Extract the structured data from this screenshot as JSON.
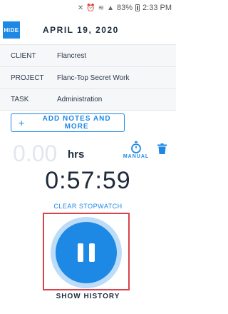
{
  "status_bar": {
    "battery": "83%",
    "time": "2:33 PM"
  },
  "header": {
    "hide_label": "HIDE",
    "date": "APRIL 19, 2020"
  },
  "fields": [
    {
      "label": "CLIENT",
      "value": "Flancrest"
    },
    {
      "label": "PROJECT",
      "value": "Flanc-Top Secret Work"
    },
    {
      "label": "TASK",
      "value": "Administration"
    }
  ],
  "notes_button": {
    "plus": "+",
    "label": "ADD NOTES AND MORE"
  },
  "hours": {
    "value": "0.00",
    "unit": "hrs"
  },
  "manual": {
    "label": "MANUAL",
    "icon": "stopwatch-icon"
  },
  "delete": {
    "icon": "trash-icon"
  },
  "timer": {
    "elapsed": "0:57:59"
  },
  "clear_label": "CLEAR STOPWATCH",
  "pause": {
    "icon": "pause-icon"
  },
  "history_label": "SHOW HISTORY",
  "colors": {
    "accent": "#1e88e5",
    "ring": "#bcdcf7",
    "highlight": "#d9434a"
  }
}
